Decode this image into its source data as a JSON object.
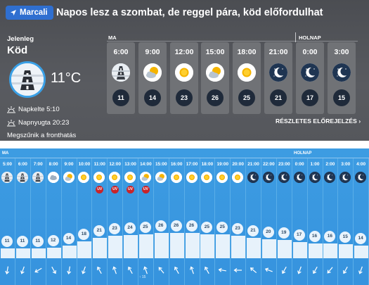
{
  "top": {
    "location_button": "Marcali",
    "headline": "Napos lesz a szombat, de reggel pára, köd előfordulhat",
    "now_label": "Jelenleg",
    "now_condition": "Köd",
    "now_temp": "11°C",
    "now_icon": "fog-icon",
    "sunrise": "Napkelte 5:10",
    "sunset": "Napnyugta 20:23",
    "trend": "Megszűnik a fronthatás",
    "label_today": "MA",
    "label_tomorrow": "HOLNAP",
    "details_link": "RÉSZLETES ELŐREJELZÉS ›",
    "forecast": [
      {
        "time": "6:00",
        "icon": "fog-icon",
        "temp": "11"
      },
      {
        "time": "9:00",
        "icon": "partly-cloudy-icon",
        "temp": "14"
      },
      {
        "time": "12:00",
        "icon": "sun-icon",
        "temp": "23"
      },
      {
        "time": "15:00",
        "icon": "partly-cloudy-icon",
        "temp": "26"
      },
      {
        "time": "18:00",
        "icon": "sun-icon",
        "temp": "25"
      },
      {
        "time": "21:00",
        "icon": "moon-icon",
        "temp": "21"
      },
      {
        "time": "0:00",
        "icon": "moon-icon",
        "temp": "17"
      },
      {
        "time": "3:00",
        "icon": "moon-icon",
        "temp": "15"
      }
    ]
  },
  "hourly": {
    "label_today": "MA",
    "label_tomorrow": "HOLNAP",
    "gust_note": "↑ 15",
    "colors": {
      "bg": "#3a98e0",
      "bar": "#ffffff",
      "uv": "#c8242a"
    },
    "hours": [
      {
        "time": "5:00",
        "icon": "fog-icon",
        "temp": 11,
        "uv": false,
        "wind_dir": 100
      },
      {
        "time": "6:00",
        "icon": "fog-icon",
        "temp": 11,
        "uv": false,
        "wind_dir": 110
      },
      {
        "time": "7:00",
        "icon": "fog-icon",
        "temp": 11,
        "uv": false,
        "wind_dir": 150
      },
      {
        "time": "8:00",
        "icon": "cloud-icon",
        "temp": 12,
        "uv": false,
        "wind_dir": 60
      },
      {
        "time": "9:00",
        "icon": "partly-cloudy-icon",
        "temp": 14,
        "uv": false,
        "wind_dir": 100
      },
      {
        "time": "10:00",
        "icon": "sun-icon",
        "temp": 18,
        "uv": false,
        "wind_dir": 110
      },
      {
        "time": "11:00",
        "icon": "sun-icon",
        "temp": 21,
        "uv": true,
        "wind_dir": 240
      },
      {
        "time": "12:00",
        "icon": "sun-icon",
        "temp": 23,
        "uv": true,
        "wind_dir": 250
      },
      {
        "time": "13:00",
        "icon": "sun-icon",
        "temp": 24,
        "uv": true,
        "wind_dir": 240
      },
      {
        "time": "14:00",
        "icon": "partly-cloudy-icon",
        "temp": 25,
        "uv": true,
        "wind_dir": 250
      },
      {
        "time": "15:00",
        "icon": "partly-cloudy-icon",
        "temp": 26,
        "uv": false,
        "wind_dir": 230
      },
      {
        "time": "16:00",
        "icon": "sun-icon",
        "temp": 26,
        "uv": false,
        "wind_dir": 240
      },
      {
        "time": "17:00",
        "icon": "sun-icon",
        "temp": 26,
        "uv": false,
        "wind_dir": 250
      },
      {
        "time": "18:00",
        "icon": "sun-icon",
        "temp": 25,
        "uv": false,
        "wind_dir": 240
      },
      {
        "time": "19:00",
        "icon": "sun-icon",
        "temp": 25,
        "uv": false,
        "wind_dir": 190
      },
      {
        "time": "20:00",
        "icon": "sun-icon",
        "temp": 23,
        "uv": false,
        "wind_dir": 180
      },
      {
        "time": "21:00",
        "icon": "moon-icon",
        "temp": 21,
        "uv": false,
        "wind_dir": 220
      },
      {
        "time": "22:00",
        "icon": "moon-icon",
        "temp": 20,
        "uv": false,
        "wind_dir": 200
      },
      {
        "time": "23:00",
        "icon": "moon-icon",
        "temp": 19,
        "uv": false,
        "wind_dir": 120
      },
      {
        "time": "0:00",
        "icon": "moon-icon",
        "temp": 17,
        "uv": false,
        "wind_dir": 110
      },
      {
        "time": "1:00",
        "icon": "moon-icon",
        "temp": 16,
        "uv": false,
        "wind_dir": 120
      },
      {
        "time": "2:00",
        "icon": "moon-icon",
        "temp": 16,
        "uv": false,
        "wind_dir": 130
      },
      {
        "time": "3:00",
        "icon": "moon-icon",
        "temp": 15,
        "uv": false,
        "wind_dir": 120
      },
      {
        "time": "4:00",
        "icon": "moon-icon",
        "temp": 14,
        "uv": false,
        "wind_dir": 110
      }
    ]
  }
}
